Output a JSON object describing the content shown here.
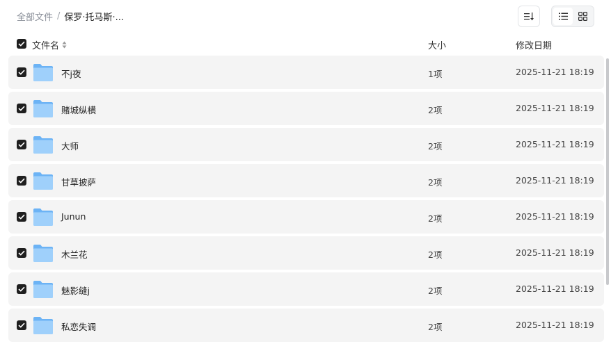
{
  "breadcrumb": {
    "root": "全部文件",
    "separator": "/",
    "current": "保罗·托马斯·..."
  },
  "toolbar": {
    "sort_icon": "sort-list-icon",
    "view_list_icon": "list-view-icon",
    "view_grid_icon": "grid-view-icon",
    "active_view": "list"
  },
  "table": {
    "headers": {
      "name": "文件名",
      "size": "大小",
      "modified": "修改日期"
    },
    "select_all_checked": true,
    "rows": [
      {
        "name": "不j夜",
        "size": "1项",
        "modified": "2025-11-21 18:19",
        "checked": true,
        "type": "folder"
      },
      {
        "name": "赌城纵横",
        "size": "2项",
        "modified": "2025-11-21 18:19",
        "checked": true,
        "type": "folder"
      },
      {
        "name": "大师",
        "size": "2项",
        "modified": "2025-11-21 18:19",
        "checked": true,
        "type": "folder"
      },
      {
        "name": "甘草披萨",
        "size": "2项",
        "modified": "2025-11-21 18:19",
        "checked": true,
        "type": "folder"
      },
      {
        "name": "Junun",
        "size": "2项",
        "modified": "2025-11-21 18:19",
        "checked": true,
        "type": "folder"
      },
      {
        "name": "木兰花",
        "size": "2项",
        "modified": "2025-11-21 18:19",
        "checked": true,
        "type": "folder"
      },
      {
        "name": "魅影缝j",
        "size": "2项",
        "modified": "2025-11-21 18:19",
        "checked": true,
        "type": "folder"
      },
      {
        "name": "私恋失调",
        "size": "2项",
        "modified": "2025-11-21 18:19",
        "checked": true,
        "type": "folder"
      }
    ]
  },
  "colors": {
    "row_bg": "#f4f4f4",
    "checkbox": "#1f1f1f",
    "folder_light": "#9fd0fb",
    "folder_dark": "#6cb3f5",
    "muted_text": "#8a8f99"
  }
}
